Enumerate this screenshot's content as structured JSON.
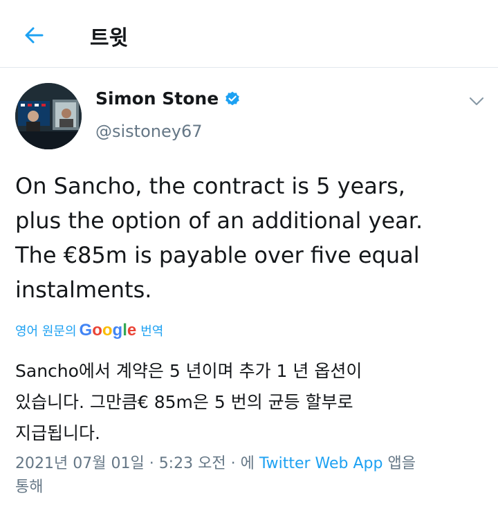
{
  "header": {
    "title": "트윗",
    "back_icon": "arrow-left-icon"
  },
  "tweet": {
    "author": {
      "name": "Simon Stone",
      "handle": "@sistoney67",
      "verified": true
    },
    "text_lines": [
      "On Sancho, the contract is 5 years,",
      "plus the option of an additional year.",
      "The €85m is payable over five equal",
      "instalments."
    ],
    "translate": {
      "prefix": "영어 원문의",
      "brand": "Google",
      "suffix": "번역"
    },
    "translated_lines": [
      "Sancho에서 계약은 5 년이며 추가 1 년 옵션이",
      "있습니다. 그만큼€ 85m은 5 번의 균등 할부로",
      "지급됩니다."
    ],
    "meta": {
      "date": "2021년 07월 01일",
      "separator": "·",
      "time": "5:23 오전",
      "via_prefix": "· 에",
      "source": "Twitter Web App",
      "via_suffix": "앱을",
      "via_suffix2": "통해"
    }
  },
  "colors": {
    "accent": "#1da1f2",
    "text": "#14171a",
    "secondary": "#657786",
    "divider": "#e1e8ed"
  }
}
